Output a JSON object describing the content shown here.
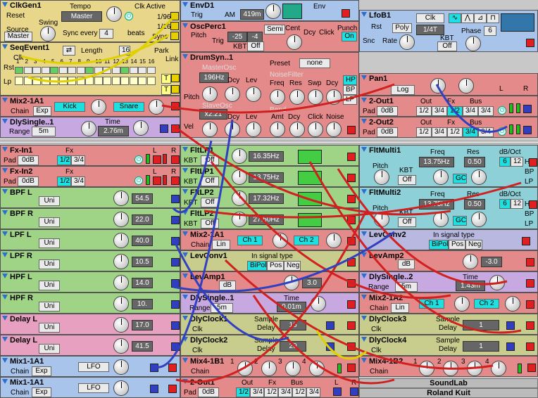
{
  "colors": {
    "yellow": "#e8d68a",
    "blue": "#a9c4ea",
    "red": "#e58a8a",
    "pink": "#e8a0c0",
    "purple": "#c8a8e0",
    "green": "#9fd487",
    "olive": "#c8cc8c",
    "lavender": "#b8b8e0",
    "teal": "#8ed0d8"
  },
  "top": {
    "clkgen": {
      "title": "ClkGen1",
      "reset": "Reset",
      "tempo_label": "Tempo",
      "tempo_value": "Master",
      "clk_active": "Clk Active",
      "source_label": "Source",
      "source_value": "Master",
      "swing": "Swing",
      "sync_label": "Sync every",
      "sync_value": "4",
      "beats": "beats",
      "r1": "1/96",
      "r2": "1/16",
      "r3": "Sync"
    },
    "seq": {
      "title": "SeqEvent1",
      "clk": "Clk",
      "length_label": "Length",
      "length_value": "16",
      "park": "Park",
      "link": "Link",
      "rst": "Rst",
      "lp": "Lp",
      "steps": [
        "1",
        "2",
        "3",
        "4",
        "5",
        "6",
        "7",
        "8",
        "9",
        "10",
        "11",
        "12",
        "13",
        "14",
        "15",
        "16"
      ],
      "t": "T"
    },
    "mix21": {
      "title": "Mix2-1A1",
      "chain": "Chain",
      "exp": "Exp",
      "kick": "Kick",
      "snare": "Snare"
    },
    "dly1": {
      "title": "DlySingle..1",
      "range": "Range",
      "range_value": "5m",
      "time_label": "Time",
      "time_value": "2.76m"
    },
    "env": {
      "title": "EnvD1",
      "trig": "Trig",
      "am": "AM",
      "value": "419m",
      "env": "Env"
    },
    "osc": {
      "title": "OscPerc1",
      "pitch": "Pitch",
      "trig": "Trig",
      "kbt": "KBT",
      "off": "Off",
      "semi": "Semi",
      "cent": "Cent",
      "dcy": "Dcy",
      "click": "Click",
      "punch": "Punch",
      "on": "On",
      "semi_val": "-25",
      "cent_val": "-4"
    },
    "drum": {
      "title": "DrumSyn..1",
      "master": "MasterOsc",
      "freq1": "196Hz",
      "dcy": "Dcy",
      "lev": "Lev",
      "preset": "Preset",
      "preset_val": "none",
      "noise": "NoiseFilter",
      "freq": "Freq",
      "res": "Res",
      "swp": "Swp",
      "hp": "HP",
      "bp": "BP",
      "lp": "LP",
      "pitch": "Pitch",
      "slave": "SlaveOsc",
      "ratio": "x2.21",
      "bend": "Bend",
      "amt": "Amt",
      "noise2": "Noise",
      "vel": "Vel"
    },
    "lfob": {
      "title": "LfoB1",
      "rst": "Rst",
      "poly": "Poly",
      "clk": "Clk",
      "rate_val": "1/4T",
      "snc": "Snc",
      "rate": "Rate",
      "kbt": "KBT",
      "off": "Off",
      "phase": "Phase",
      "phase_val": "6"
    },
    "pan": {
      "title": "Pan1",
      "log": "Log",
      "l": "L",
      "r": "R"
    },
    "out1": {
      "title": "2-Out1",
      "pad": "Pad",
      "db": "0dB",
      "out": "Out",
      "fx": "Fx",
      "bus": "Bus",
      "o1": "1/2",
      "o2": "3/4",
      "l": "L",
      "r": "R"
    },
    "out2": {
      "title": "2-Out2",
      "pad": "Pad",
      "db": "0dB",
      "out": "Out",
      "fx": "Fx",
      "bus": "Bus",
      "o1": "1/2",
      "o2": "3/4",
      "l": "L",
      "r": "R"
    }
  },
  "col1": [
    {
      "title": "Fx-In1",
      "pad": "Pad",
      "db": "0dB",
      "fx": "Fx",
      "o1": "1/2",
      "o2": "3/4",
      "l": "L",
      "r": "R",
      "color": "red"
    },
    {
      "title": "Fx-In2",
      "pad": "Pad",
      "db": "0dB",
      "fx": "Fx",
      "o1": "1/2",
      "o2": "3/4",
      "l": "L",
      "r": "R",
      "color": "red"
    },
    {
      "title": "BPF L",
      "mode": "Uni",
      "value": "54.5",
      "color": "green"
    },
    {
      "title": "BPF R",
      "mode": "Uni",
      "value": "22.0",
      "color": "green"
    },
    {
      "title": "LPF L",
      "mode": "Uni",
      "value": "40.0",
      "color": "green"
    },
    {
      "title": "LPF R",
      "mode": "Uni",
      "value": "10.5",
      "color": "green"
    },
    {
      "title": "HPF L",
      "mode": "Uni",
      "value": "14.0",
      "color": "green"
    },
    {
      "title": "HPF R",
      "mode": "Uni",
      "value": "10.",
      "color": "green"
    },
    {
      "title": "Delay L",
      "mode": "Uni",
      "value": "17.0",
      "color": "pink"
    },
    {
      "title": "Delay L",
      "mode": "Uni",
      "value": "41.5",
      "color": "pink"
    },
    {
      "title": "Mix1-1A1",
      "chain": "Chain",
      "exp": "Exp",
      "lfo": "LFO",
      "color": "blue"
    },
    {
      "title": "Mix1-1A1",
      "chain": "Chain",
      "exp": "Exp",
      "lfo": "LFO",
      "color": "blue"
    }
  ],
  "col2": {
    "flt1": {
      "title": "FltLP1",
      "kbt": "KBT",
      "off": "Off",
      "freq": "16.35Hz"
    },
    "flt2": {
      "title": "FltLP1",
      "kbt": "KBT",
      "off": "Off",
      "freq": "13.75Hz"
    },
    "flt3": {
      "title": "FltLP2",
      "kbt": "KBT",
      "off": "Off",
      "freq": "17.32Hz"
    },
    "flt4": {
      "title": "FltLP2",
      "kbt": "KBT",
      "off": "Off",
      "freq": "27.50Hz"
    },
    "mix": {
      "title": "Mix2-1A1",
      "chain": "Chain",
      "lin": "Lin",
      "ch1": "Ch 1",
      "ch2": "Ch 2"
    },
    "lev": {
      "title": "LevConv1",
      "sig": "In signal type",
      "bipol": "BiPol",
      "pos": "Pos",
      "neg": "Neg"
    },
    "amp": {
      "title": "LevAmp1",
      "db": "dB",
      "value": "3.0"
    },
    "dly": {
      "title": "DlySingle..1",
      "range": "Range",
      "range_value": "5m",
      "time_label": "Time",
      "time_value": "0.01m"
    },
    "clk1": {
      "title": "DlyClock1",
      "clk": "Clk",
      "sample": "Sample",
      "delay": "Delay",
      "value": "16"
    },
    "clk2": {
      "title": "DlyClock2",
      "clk": "Clk",
      "sample": "Sample",
      "delay": "Delay",
      "value": "20"
    },
    "mix4": {
      "title": "Mix4-1B1",
      "chain": "Chain",
      "n1": "1",
      "n2": "2",
      "n3": "3",
      "n4": "4"
    },
    "out": {
      "title": "2-Out1",
      "pad": "Pad",
      "db": "0dB",
      "out": "Out",
      "fx": "Fx",
      "bus": "Bus",
      "o1": "1/2",
      "o2": "3/4",
      "l": "L",
      "r": "R"
    }
  },
  "col3": {
    "m1": {
      "title": "FltMulti1",
      "freq": "Freq",
      "res": "Res",
      "db_oct": "dB/Oct",
      "freq_val": "13.75Hz",
      "res_val": "0.50",
      "pitch": "Pitch",
      "kbt": "KBT",
      "off": "Off",
      "gc": "GC",
      "hp": "HP",
      "bp": "BP",
      "lp": "LP",
      "n1": "6",
      "n2": "12"
    },
    "m2": {
      "title": "FltMulti2",
      "freq": "Freq",
      "res": "Res",
      "db_oct": "dB/Oct",
      "freq_val": "13.75Hz",
      "res_val": "0.50",
      "pitch": "Pitch",
      "kbt": "KBT",
      "off": "Off",
      "gc": "GC",
      "hp": "HP",
      "bp": "BP",
      "lp": "LP",
      "n1": "6",
      "n2": "12"
    },
    "lev": {
      "title": "LevConv2",
      "sig": "In signal type",
      "bipol": "BiPol",
      "pos": "Pos",
      "neg": "Neg"
    },
    "amp": {
      "title": "LevAmp2",
      "db": "dB",
      "value": "-3.0"
    },
    "dly": {
      "title": "DlySingle..2",
      "range": "Range",
      "range_value": "5m",
      "time_label": "Time",
      "time_value": "1.43m"
    },
    "mix": {
      "title": "Mix2-1A2",
      "chain": "Chain",
      "lin": "Lin",
      "ch1": "Ch 1",
      "ch2": "Ch 2"
    },
    "clk3": {
      "title": "DlyClock3",
      "clk": "Clk",
      "sample": "Sample",
      "delay": "Delay",
      "value": "1"
    },
    "clk4": {
      "title": "DlyClock4",
      "clk": "Clk",
      "sample": "Sample",
      "delay": "Delay",
      "value": "1"
    },
    "mix4": {
      "title": "Mix4-1B2",
      "chain": "Chain",
      "n1": "1",
      "n2": "2",
      "n3": "3",
      "n4": "4"
    },
    "credit1": "SoundLab",
    "credit2": "Roland Kuit"
  }
}
